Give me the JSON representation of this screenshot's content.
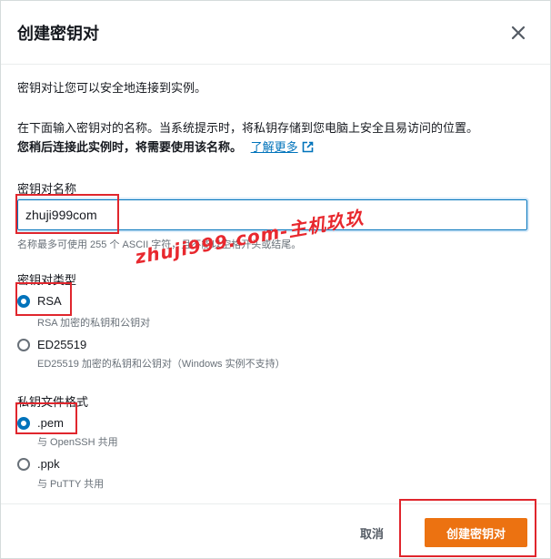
{
  "dialog": {
    "title": "创建密钥对",
    "intro": "密钥对让您可以安全地连接到实例。",
    "instruction_line1": "在下面输入密钥对的名称。当系统提示时，将私钥存储到您电脑上安全且易访问的位置。",
    "instruction_line2": "您稍后连接此实例时，将需要使用该名称。",
    "learn_more": "了解更多"
  },
  "name_field": {
    "label": "密钥对名称",
    "value": "zhuji999com",
    "hint": "名称最多可使用 255 个 ASCII 字符，且不能以空格开头或结尾。"
  },
  "key_type": {
    "label": "密钥对类型",
    "options": [
      {
        "label": "RSA",
        "desc": "RSA 加密的私钥和公钥对",
        "selected": true
      },
      {
        "label": "ED25519",
        "desc": "ED25519 加密的私钥和公钥对（Windows 实例不支持）",
        "selected": false
      }
    ]
  },
  "file_format": {
    "label": "私钥文件格式",
    "options": [
      {
        "label": ".pem",
        "desc": "与 OpenSSH 共用",
        "selected": true
      },
      {
        "label": ".ppk",
        "desc": "与 PuTTY 共用",
        "selected": false
      }
    ]
  },
  "footer": {
    "cancel": "取消",
    "create": "创建密钥对"
  },
  "watermark": "zhuji999.com-主机玖玖",
  "colors": {
    "primary": "#ec7211",
    "link": "#0073bb",
    "highlight": "#e0262d"
  }
}
